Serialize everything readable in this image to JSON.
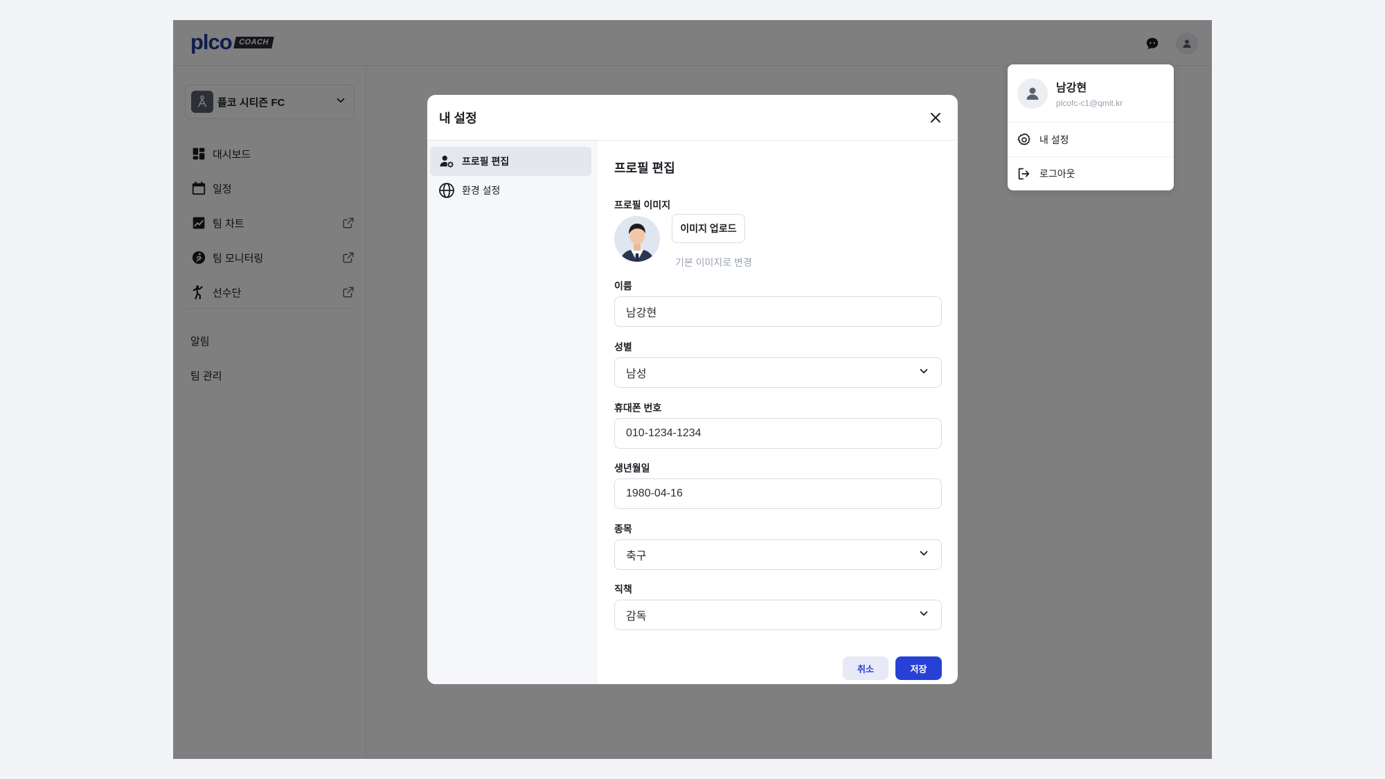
{
  "topbar": {
    "logo_word": "plco",
    "logo_badge": "COACH",
    "chat_icon": "chat-bubble-icon",
    "profile_icon": "user-icon"
  },
  "sidebar": {
    "team_name": "플코 시티즌 FC",
    "items": [
      {
        "label": "대시보드",
        "icon": "dashboard-icon",
        "external": false
      },
      {
        "label": "일정",
        "icon": "calendar-icon",
        "external": false
      },
      {
        "label": "팀 차트",
        "icon": "chart-icon",
        "external": true
      },
      {
        "label": "팀 모니터링",
        "icon": "running-icon",
        "external": true
      },
      {
        "label": "선수단",
        "icon": "player-icon",
        "external": true
      }
    ],
    "secondary": [
      {
        "label": "알림"
      },
      {
        "label": "팀 관리"
      }
    ]
  },
  "user_menu": {
    "name": "남강현",
    "email": "plcofc-c1@qmit.kr",
    "items": [
      {
        "label": "내 설정",
        "icon": "settings-icon"
      },
      {
        "label": "로그아웃",
        "icon": "logout-icon"
      }
    ]
  },
  "modal": {
    "title": "내 설정",
    "side_items": [
      {
        "label": "프로필 편집",
        "icon": "user-settings-icon",
        "active": true
      },
      {
        "label": "환경 설정",
        "icon": "globe-icon",
        "active": false
      }
    ],
    "section_title": "프로필 편집",
    "profile_image_label": "프로필 이미지",
    "upload_label": "이미지 업로드",
    "reset_label": "기본 이미지로 변경",
    "fields": {
      "name": {
        "label": "이름",
        "value": "남강현"
      },
      "gender": {
        "label": "성별",
        "value": "남성"
      },
      "phone": {
        "label": "휴대폰 번호",
        "value": "010-1234-1234"
      },
      "birth": {
        "label": "생년월일",
        "value": "1980-04-16"
      },
      "sport": {
        "label": "종목",
        "value": "축구"
      },
      "role": {
        "label": "직책",
        "value": "감독"
      }
    },
    "cancel_label": "취소",
    "save_label": "저장"
  },
  "colors": {
    "primary": "#2741d6",
    "brand": "#1f3a9a",
    "cancel_bg": "#e7e9f7"
  }
}
